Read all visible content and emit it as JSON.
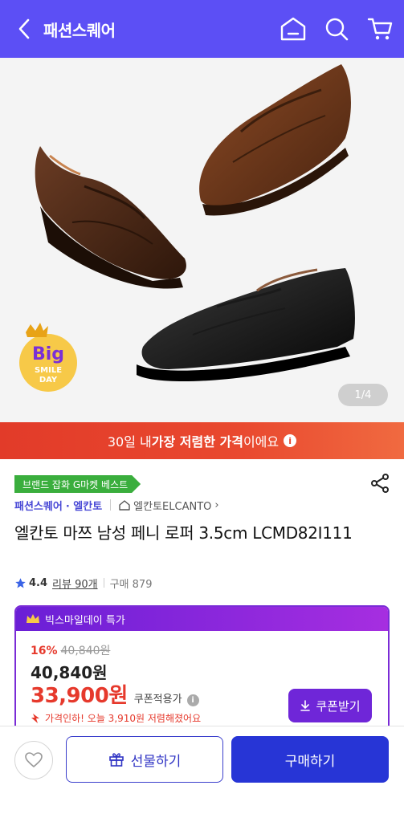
{
  "header": {
    "title": "패션스퀘어",
    "icons": [
      "back-icon",
      "home-icon",
      "search-icon",
      "cart-icon"
    ],
    "bg_color": "#5c4ff5"
  },
  "gallery": {
    "page_indicator": "1/4",
    "badge": {
      "line1": "Big",
      "line2": "SMILE",
      "line3": "DAY"
    }
  },
  "promo": {
    "prefix": "30일 내 ",
    "highlight": "가장 저렴한 가격",
    "suffix": "이에요",
    "info_icon": "i"
  },
  "product": {
    "best_tag": "브랜드 잡화 G마켓 베스트",
    "seller": "패션스퀘어",
    "brand": "· 엘칸토",
    "shop": "엘칸토ELCANTO",
    "shop_chevron": "›",
    "title": "엘칸토 마쯔 남성 페니 로퍼 3.5cm LCMD82I111",
    "rating": "4.4",
    "reviews": "리뷰 90개",
    "purchases": "구매 879"
  },
  "deal": {
    "header": "빅스마일데이 특가",
    "discount_pct": "16%",
    "original_price": "40,840원",
    "price": "40,840원",
    "coupon_price": "33,900원",
    "coupon_label": "쿠폰적용가",
    "price_cut_msg": "가격인하! 오늘 3,910원 저렴해졌어요",
    "coupon_button": "쿠폰받기",
    "accent": "#6f26d8"
  },
  "actions": {
    "gift_label": "선물하기",
    "buy_label": "구매하기",
    "buy_color": "#2735d6"
  }
}
